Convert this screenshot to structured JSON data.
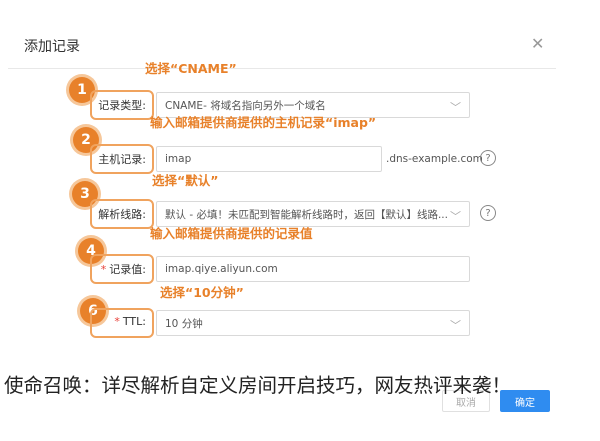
{
  "dialog": {
    "title": "添加记录",
    "close_icon": "close-icon"
  },
  "rows": [
    {
      "num": "1",
      "annotation": "选择“CNAME”",
      "label": "记录类型:",
      "value": "CNAME- 将域名指向另外一个域名",
      "type": "select"
    },
    {
      "num": "2",
      "annotation_plain": "输入邮箱提供商提供的主机记录“",
      "annotation_under": "imap",
      "annotation_tail": "”",
      "label": "主机记录:",
      "value": "imap",
      "suffix": ".dns-example.com",
      "type": "input"
    },
    {
      "num": "3",
      "annotation": "选择“默认”",
      "label": "解析线路:",
      "value": "默认 - 必填！未匹配到智能解析线路时，返回【默认】线路...",
      "type": "select"
    },
    {
      "num": "4",
      "annotation": "输入邮箱提供商提供的记录值",
      "label": "记录值:",
      "value": "imap.qiye.aliyun.com",
      "type": "input",
      "required": true
    },
    {
      "num": "6",
      "annotation": "选择“10分钟”",
      "label": "TTL:",
      "value": "10 分钟",
      "type": "select",
      "required": true
    }
  ],
  "buttons": {
    "cancel": "取消",
    "ok": "确定"
  },
  "required_mark": "*",
  "caption": "使命召唤：详尽解析自定义房间开启技巧，网友热评来袭！"
}
